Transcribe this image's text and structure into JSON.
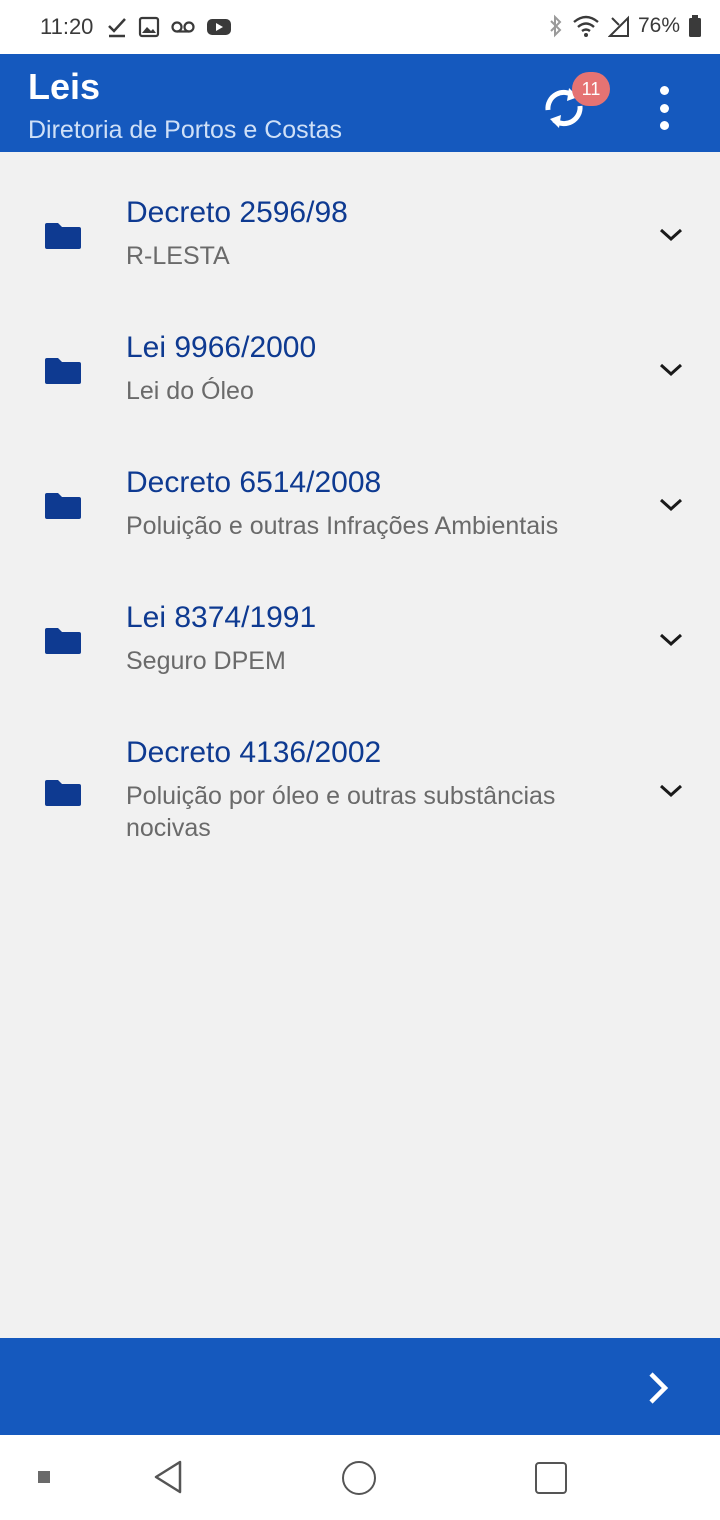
{
  "status_bar": {
    "time": "11:20",
    "battery": "76%",
    "left_icons": [
      "check-icon",
      "image-icon",
      "voicemail-icon",
      "youtube-icon"
    ],
    "right_icons": [
      "bluetooth-icon",
      "wifi-icon",
      "signal-icon",
      "battery-icon"
    ]
  },
  "app_bar": {
    "title": "Leis",
    "subtitle": "Diretoria de Portos e Costas",
    "sync_badge": "11",
    "background": "#1559be"
  },
  "laws": [
    {
      "title": "Decreto 2596/98",
      "subtitle": "R-LESTA"
    },
    {
      "title": "Lei 9966/2000",
      "subtitle": "Lei do Óleo"
    },
    {
      "title": "Decreto 6514/2008",
      "subtitle": "Poluição e outras Infrações Ambientais"
    },
    {
      "title": "Lei 8374/1991",
      "subtitle": "Seguro DPEM"
    },
    {
      "title": "Decreto 4136/2002",
      "subtitle": "Poluição por óleo e outras substâncias nocivas"
    }
  ],
  "colors": {
    "title_text": "#0e3a91",
    "folder_icon": "#0e3a91",
    "subtitle_text": "#6a6a6a",
    "badge": "#e57373"
  }
}
